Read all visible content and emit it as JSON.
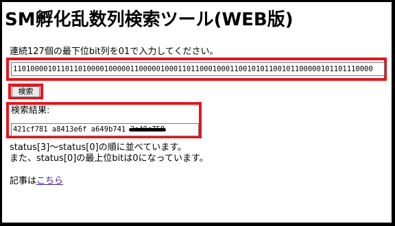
{
  "page": {
    "title": "SM孵化乱数列検索ツール(WEB版)",
    "instruction": "連続127個の最下位bit列を01で入力してください。"
  },
  "search": {
    "bits_value": "11010000101101101000010000011000001000110110001000110010101100101100000101101110000",
    "button_label": "検索"
  },
  "result": {
    "label": "検索結果:",
    "visible_value": "421cf781 a8413e6f a649b741 ",
    "redacted_value": "3e49c759"
  },
  "notes": {
    "line1": "status[3]〜status[0]の順に並べています。",
    "line2": "また、status[0]の最上位bitは0になっています。"
  },
  "article": {
    "prefix": "記事は",
    "link_text": "こちら"
  },
  "colors": {
    "highlight_border": "#e8141c",
    "link": "#4b1a8f",
    "background_frame": "#000000"
  }
}
